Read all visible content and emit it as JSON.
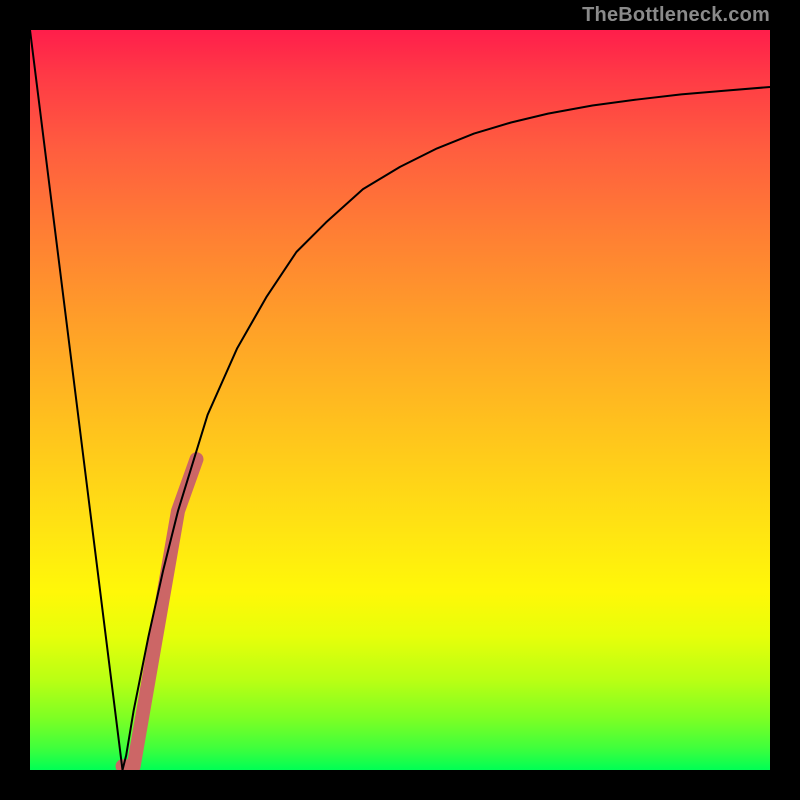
{
  "watermark": "TheBottleneck.com",
  "chart_data": {
    "type": "line",
    "title": "",
    "xlabel": "",
    "ylabel": "",
    "xlim": [
      0,
      100
    ],
    "ylim": [
      0,
      100
    ],
    "grid": false,
    "legend": false,
    "series": [
      {
        "name": "bottleneck-curve",
        "color": "#000000",
        "stroke_width": 2,
        "x": [
          0,
          3,
          6,
          9,
          12,
          12.5,
          13,
          14,
          16,
          18,
          20,
          24,
          28,
          32,
          36,
          40,
          45,
          50,
          55,
          60,
          65,
          70,
          76,
          82,
          88,
          94,
          100
        ],
        "y": [
          100,
          76,
          52,
          28,
          4,
          0,
          2,
          8,
          18,
          27,
          35,
          48,
          57,
          64,
          70,
          74,
          78.5,
          81.5,
          84,
          86,
          87.5,
          88.7,
          89.8,
          90.6,
          91.3,
          91.8,
          92.3
        ]
      },
      {
        "name": "highlight-segment",
        "color": "#cc6666",
        "stroke_width": 14,
        "linecap": "round",
        "x": [
          12.5,
          14.0,
          20.0,
          22.5
        ],
        "y": [
          0.5,
          0.5,
          35.0,
          42.0
        ]
      }
    ],
    "gradient_stops": [
      {
        "pos": 0,
        "color": "#ff1e4b"
      },
      {
        "pos": 6,
        "color": "#ff3946"
      },
      {
        "pos": 16,
        "color": "#ff5d3f"
      },
      {
        "pos": 28,
        "color": "#ff8033"
      },
      {
        "pos": 40,
        "color": "#ffa028"
      },
      {
        "pos": 54,
        "color": "#ffc31d"
      },
      {
        "pos": 68,
        "color": "#ffe512"
      },
      {
        "pos": 76,
        "color": "#fff808"
      },
      {
        "pos": 82,
        "color": "#e6ff0a"
      },
      {
        "pos": 88,
        "color": "#b8ff14"
      },
      {
        "pos": 93,
        "color": "#7dff24"
      },
      {
        "pos": 97,
        "color": "#40ff3c"
      },
      {
        "pos": 100,
        "color": "#00ff55"
      }
    ]
  }
}
